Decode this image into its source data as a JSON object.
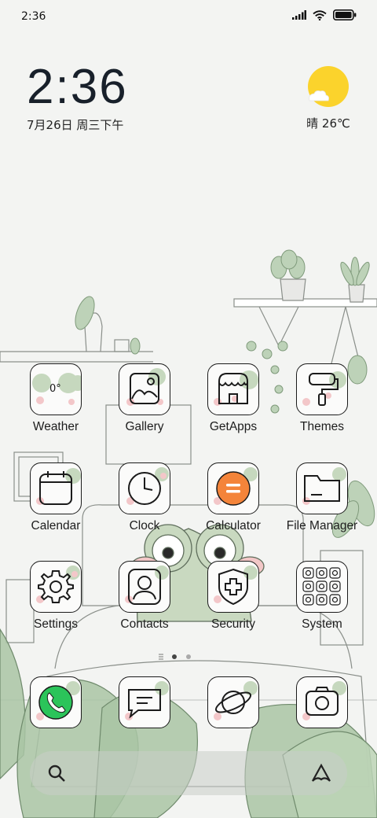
{
  "status": {
    "time": "2:36"
  },
  "clock": {
    "time": "2:36",
    "date": "7月26日 周三下午"
  },
  "weather": {
    "text": "晴 26℃",
    "icon": "sun-cloud-icon"
  },
  "apps": [
    {
      "label": "Weather",
      "temp": "0°"
    },
    {
      "label": "Gallery"
    },
    {
      "label": "GetApps"
    },
    {
      "label": "Themes"
    },
    {
      "label": "Calendar"
    },
    {
      "label": "Clock"
    },
    {
      "label": "Calculator"
    },
    {
      "label": "File Manager"
    },
    {
      "label": "Settings"
    },
    {
      "label": "Contacts"
    },
    {
      "label": "Security"
    },
    {
      "label": "System"
    }
  ],
  "dock": [
    {
      "icon": "phone-icon"
    },
    {
      "icon": "messages-icon"
    },
    {
      "icon": "browser-icon"
    },
    {
      "icon": "camera-icon"
    }
  ],
  "page_indicator": {
    "pages": 2,
    "current": 1
  },
  "search": {
    "left_icon": "search-icon",
    "right_icon": "assistant-icon"
  },
  "colors": {
    "accent_orange": "#f4843a",
    "phone_green": "#2bc45a",
    "sun_yellow": "#fbd32c",
    "frog_green": "#b8cdb0"
  }
}
